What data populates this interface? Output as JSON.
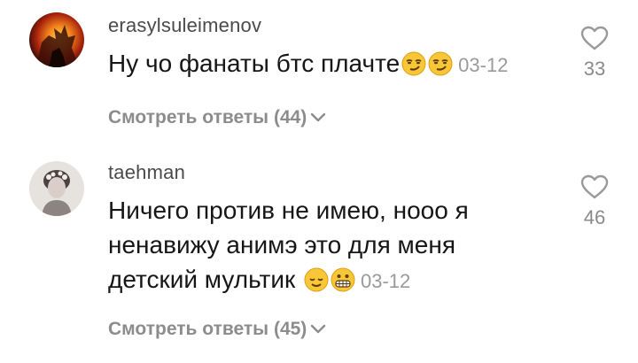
{
  "comments": [
    {
      "username": "erasylsuleimenov",
      "text": "Ну чо фанаты бтс плачте",
      "emojis": [
        "smirking-face-emoji",
        "smirking-face-emoji"
      ],
      "date": "03-12",
      "likes": "33",
      "replies_label": "Смотреть ответы (44)"
    },
    {
      "username": "taehman",
      "text": "Ничего против не имею, нооо я ненавижу анимэ это для меня детский мультик",
      "emojis": [
        "relieved-face-emoji",
        "grimacing-face-emoji"
      ],
      "date": "03-12",
      "likes": "46",
      "replies_label": "Смотреть ответы (45)"
    }
  ],
  "colors": {
    "username": "#4a4a4a",
    "text": "#161616",
    "meta": "#9a9a9a",
    "replies": "#8c8c8c"
  }
}
